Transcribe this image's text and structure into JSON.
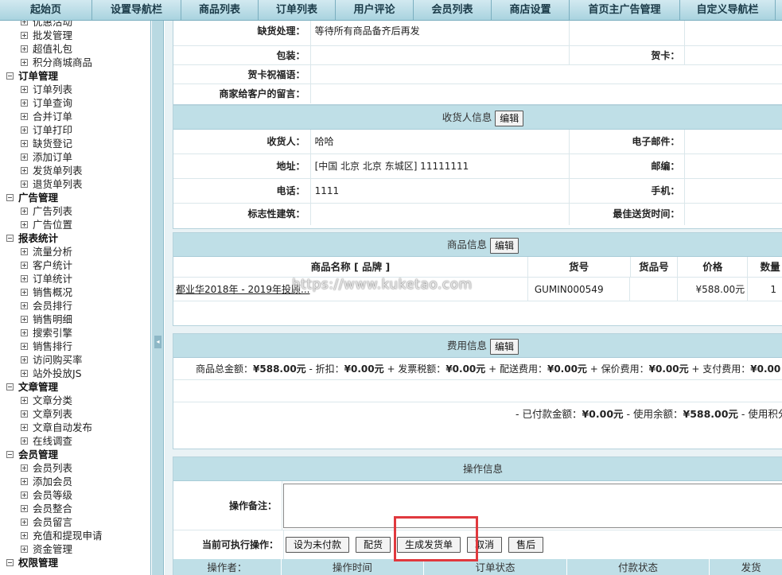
{
  "topnav": [
    "起始页",
    "设置导航栏",
    "商品列表",
    "订单列表",
    "用户评论",
    "会员列表",
    "商店设置",
    "首页主广告管理",
    "自定义导航栏"
  ],
  "sidebar": {
    "groups": [
      {
        "title": "",
        "items": [
          "优惠活动",
          "批发管理",
          "超值礼包",
          "积分商城商品"
        ]
      },
      {
        "title": "订单管理",
        "items": [
          "订单列表",
          "订单查询",
          "合并订单",
          "订单打印",
          "缺货登记",
          "添加订单",
          "发货单列表",
          "退货单列表"
        ]
      },
      {
        "title": "广告管理",
        "items": [
          "广告列表",
          "广告位置"
        ]
      },
      {
        "title": "报表统计",
        "items": [
          "流量分析",
          "客户统计",
          "订单统计",
          "销售概况",
          "会员排行",
          "销售明细",
          "搜索引擎",
          "销售排行",
          "访问购买率",
          "站外投放JS"
        ]
      },
      {
        "title": "文章管理",
        "items": [
          "文章分类",
          "文章列表",
          "文章自动发布",
          "在线调查"
        ]
      },
      {
        "title": "会员管理",
        "items": [
          "会员列表",
          "添加会员",
          "会员等级",
          "会员整合",
          "会员留言",
          "充值和提现申请",
          "资金管理"
        ]
      },
      {
        "title": "权限管理",
        "items": []
      }
    ]
  },
  "other_info": {
    "shortage_label": "缺货处理：",
    "shortage_value": "等待所有商品备齐后再发",
    "package_label": "包装：",
    "card_label": "贺卡：",
    "card_msg_label": "贺卡祝福语：",
    "merchant_msg_label": "商家给客户的留言："
  },
  "consignee": {
    "header": "收货人信息",
    "edit": "编辑",
    "name_label": "收货人：",
    "name": "哈哈",
    "email_label": "电子邮件：",
    "address_label": "地址：",
    "address": "[中国 北京 北京 东城区] 11111111",
    "zip_label": "邮编：",
    "phone_label": "电话：",
    "phone": "1111",
    "mobile_label": "手机：",
    "landmark_label": "标志性建筑：",
    "best_time_label": "最佳送货时间："
  },
  "goods": {
    "header": "商品信息",
    "edit": "编辑",
    "columns": [
      "商品名称 [ 品牌 ]",
      "货号",
      "货品号",
      "价格",
      "数量"
    ],
    "rows": [
      {
        "name": "都业华2018年 - 2019年投顾...",
        "sn": "GUMIN000549",
        "product_sn": "",
        "price": "¥588.00元",
        "qty": "1"
      }
    ]
  },
  "fee": {
    "header": "费用信息",
    "edit": "编辑",
    "line1": [
      "商品总金额：",
      "¥588.00元",
      " - 折扣：",
      "¥0.00元",
      " + 发票税额：",
      "¥0.00元",
      " + 配送费用：",
      "¥0.00元",
      " + 保价费用：",
      "¥0.00元",
      " + 支付费用：",
      "¥0.00"
    ],
    "line2": [
      "- 已付款金额：",
      "¥0.00元",
      " - 使用余额：",
      "¥588.00元",
      " - 使用积分"
    ]
  },
  "action": {
    "header": "操作信息",
    "note_label": "操作备注：",
    "ops_label": "当前可执行操作：",
    "buttons": [
      "设为未付款",
      "配货",
      "生成发货单",
      "取消",
      "售后"
    ],
    "log_columns": [
      "操作者：",
      "操作时间",
      "订单状态",
      "付款状态",
      "发货"
    ]
  },
  "watermark": "https://www.kuketao.com"
}
